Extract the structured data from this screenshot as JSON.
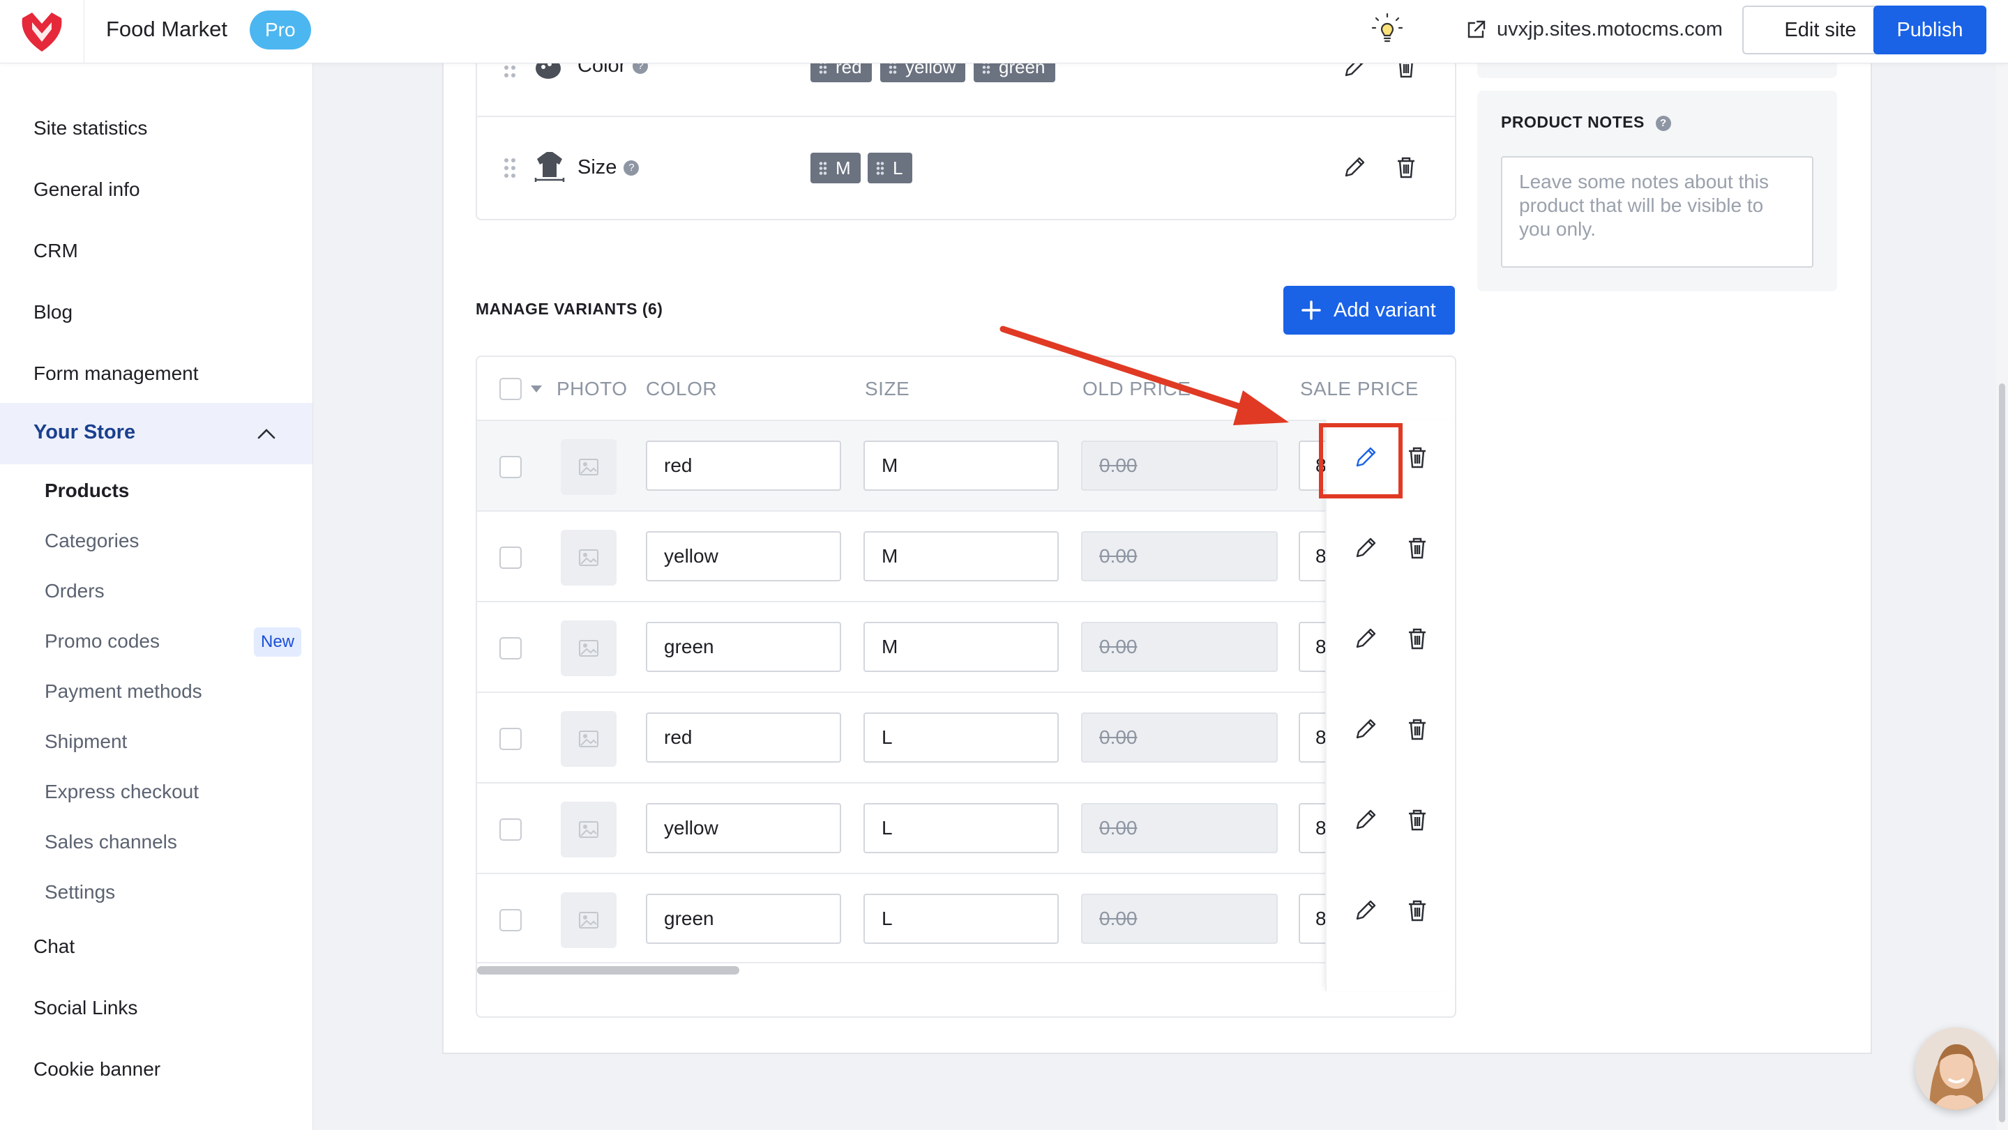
{
  "header": {
    "site_title": "Food Market",
    "plan_badge": "Pro",
    "site_url": "uvxjp.sites.motocms.com",
    "edit_site_label": "Edit site",
    "publish_label": "Publish",
    "brand_color": "#e5293a",
    "accent_color": "#1a62e6"
  },
  "sidebar": {
    "items": [
      {
        "label": "Site statistics"
      },
      {
        "label": "General info"
      },
      {
        "label": "CRM"
      },
      {
        "label": "Blog"
      },
      {
        "label": "Form management"
      }
    ],
    "store": {
      "label": "Your Store",
      "subitems": [
        {
          "label": "Products"
        },
        {
          "label": "Categories"
        },
        {
          "label": "Orders"
        },
        {
          "label": "Promo codes",
          "badge": "New"
        },
        {
          "label": "Payment methods"
        },
        {
          "label": "Shipment"
        },
        {
          "label": "Express checkout"
        },
        {
          "label": "Sales channels"
        },
        {
          "label": "Settings"
        }
      ]
    },
    "after_items": [
      {
        "label": "Chat"
      },
      {
        "label": "Social Links"
      },
      {
        "label": "Cookie banner"
      }
    ]
  },
  "attributes": [
    {
      "name": "Color",
      "values": [
        "red",
        "yellow",
        "green"
      ]
    },
    {
      "name": "Size",
      "values": [
        "M",
        "L"
      ]
    }
  ],
  "variants": {
    "title": "MANAGE VARIANTS (6)",
    "add_label": "Add variant",
    "columns": [
      "PHOTO",
      "COLOR",
      "SIZE",
      "OLD PRICE",
      "SALE PRICE"
    ],
    "rows": [
      {
        "color": "red",
        "size": "M",
        "old_price": "0.00",
        "sale_price": "8"
      },
      {
        "color": "yellow",
        "size": "M",
        "old_price": "0.00",
        "sale_price": "8"
      },
      {
        "color": "green",
        "size": "M",
        "old_price": "0.00",
        "sale_price": "8"
      },
      {
        "color": "red",
        "size": "L",
        "old_price": "0.00",
        "sale_price": "8"
      },
      {
        "color": "yellow",
        "size": "L",
        "old_price": "0.00",
        "sale_price": "8"
      },
      {
        "color": "green",
        "size": "L",
        "old_price": "0.00",
        "sale_price": "8"
      }
    ]
  },
  "product_notes": {
    "title": "PRODUCT NOTES",
    "placeholder": "Leave some notes about this product that will be visible to you only."
  }
}
